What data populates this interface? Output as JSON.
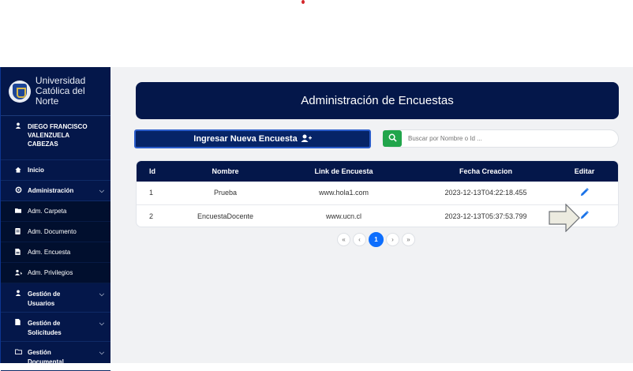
{
  "brand": {
    "line1": "Universidad",
    "line2": "Católica del Norte"
  },
  "user": {
    "name": "DIEGO FRANCISCO VALENZUELA CABEZAS"
  },
  "sidebar": {
    "inicio": "Inicio",
    "administracion": "Administración",
    "sub_items": [
      "Adm. Carpeta",
      "Adm. Documento",
      "Adm. Encuesta",
      "Adm. Privilegios"
    ],
    "gestion_usuarios": "Gestión de Usuarios",
    "gestion_solicitudes": "Gestión de Solicitudes",
    "gestion_documental": "Gestión Documental"
  },
  "page": {
    "title": "Administración de Encuestas",
    "new_button": "Ingresar Nueva Encuesta",
    "search_placeholder": "Buscar por Nombre o Id ..."
  },
  "table": {
    "headers": [
      "Id",
      "Nombre",
      "Link de Encuesta",
      "Fecha Creacion",
      "Editar"
    ],
    "rows": [
      {
        "id": "1",
        "nombre": "Prueba",
        "link": "www.hola1.com",
        "fecha": "2023-12-13T04:22:18.455"
      },
      {
        "id": "2",
        "nombre": "EncuestaDocente",
        "link": "www.ucn.cl",
        "fecha": "2023-12-13T05:37:53.799"
      }
    ]
  },
  "pagination": {
    "first": "«",
    "prev": "‹",
    "current": "1",
    "next": "›",
    "last": "»"
  },
  "colors": {
    "navy": "#04174a",
    "accent_blue": "#0d6efd",
    "search_green": "#21a54b"
  },
  "icons": [
    "user-icon",
    "home-icon",
    "gear-icon",
    "folder-icon",
    "document-icon",
    "survey-icon",
    "privileges-icon",
    "search-icon",
    "user-plus-icon",
    "pencil-icon",
    "arrow-right-icon"
  ]
}
